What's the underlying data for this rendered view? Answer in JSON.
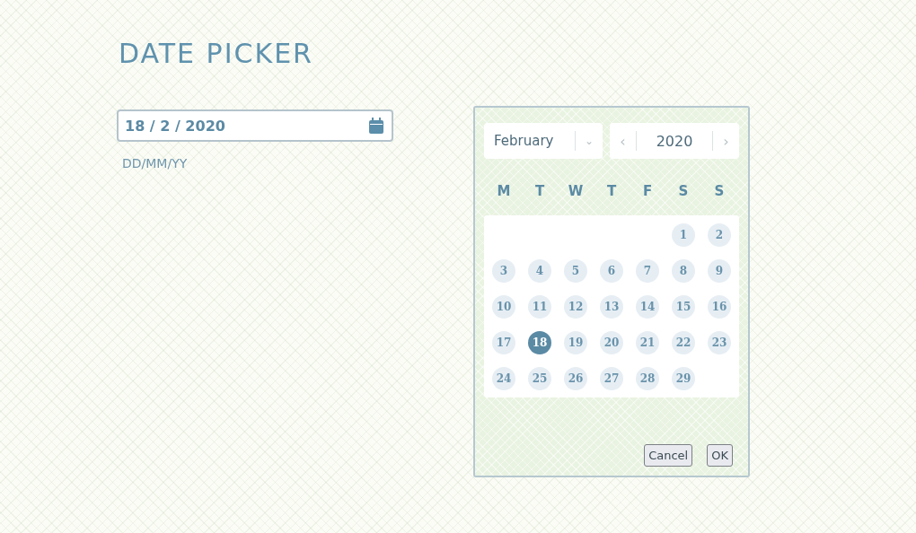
{
  "title": "DATE PICKER",
  "date_field": {
    "value": "18 / 2 / 2020",
    "hint": "DD/MM/YY"
  },
  "calendar": {
    "month": "February",
    "month_toggle": "⌄",
    "year_prev": "‹",
    "year": "2020",
    "year_next": "›",
    "weekdays": [
      "M",
      "T",
      "W",
      "T",
      "F",
      "S",
      "S"
    ],
    "weeks": [
      [
        {
          "kind": "blank"
        },
        {
          "kind": "blank"
        },
        {
          "kind": "blank"
        },
        {
          "kind": "blank"
        },
        {
          "kind": "blank"
        },
        {
          "kind": "day",
          "label": "1",
          "selected": false
        },
        {
          "kind": "day",
          "label": "2",
          "selected": false
        }
      ],
      [
        {
          "kind": "day",
          "label": "3",
          "selected": false
        },
        {
          "kind": "day",
          "label": "4",
          "selected": false
        },
        {
          "kind": "day",
          "label": "5",
          "selected": false
        },
        {
          "kind": "day",
          "label": "6",
          "selected": false
        },
        {
          "kind": "day",
          "label": "7",
          "selected": false
        },
        {
          "kind": "day",
          "label": "8",
          "selected": false
        },
        {
          "kind": "day",
          "label": "9",
          "selected": false
        }
      ],
      [
        {
          "kind": "day",
          "label": "10",
          "selected": false
        },
        {
          "kind": "day",
          "label": "11",
          "selected": false
        },
        {
          "kind": "day",
          "label": "12",
          "selected": false
        },
        {
          "kind": "day",
          "label": "13",
          "selected": false
        },
        {
          "kind": "day",
          "label": "14",
          "selected": false
        },
        {
          "kind": "day",
          "label": "15",
          "selected": false
        },
        {
          "kind": "day",
          "label": "16",
          "selected": false
        }
      ],
      [
        {
          "kind": "day",
          "label": "17",
          "selected": false
        },
        {
          "kind": "day",
          "label": "18",
          "selected": true
        },
        {
          "kind": "day",
          "label": "19",
          "selected": false
        },
        {
          "kind": "day",
          "label": "20",
          "selected": false
        },
        {
          "kind": "day",
          "label": "21",
          "selected": false
        },
        {
          "kind": "day",
          "label": "22",
          "selected": false
        },
        {
          "kind": "day",
          "label": "23",
          "selected": false
        }
      ],
      [
        {
          "kind": "day",
          "label": "24",
          "selected": false
        },
        {
          "kind": "day",
          "label": "25",
          "selected": false
        },
        {
          "kind": "day",
          "label": "26",
          "selected": false
        },
        {
          "kind": "day",
          "label": "27",
          "selected": false
        },
        {
          "kind": "day",
          "label": "28",
          "selected": false
        },
        {
          "kind": "day",
          "label": "29",
          "selected": false
        },
        {
          "kind": "blank"
        }
      ]
    ],
    "buttons": [
      "Cancel",
      "OK"
    ]
  }
}
